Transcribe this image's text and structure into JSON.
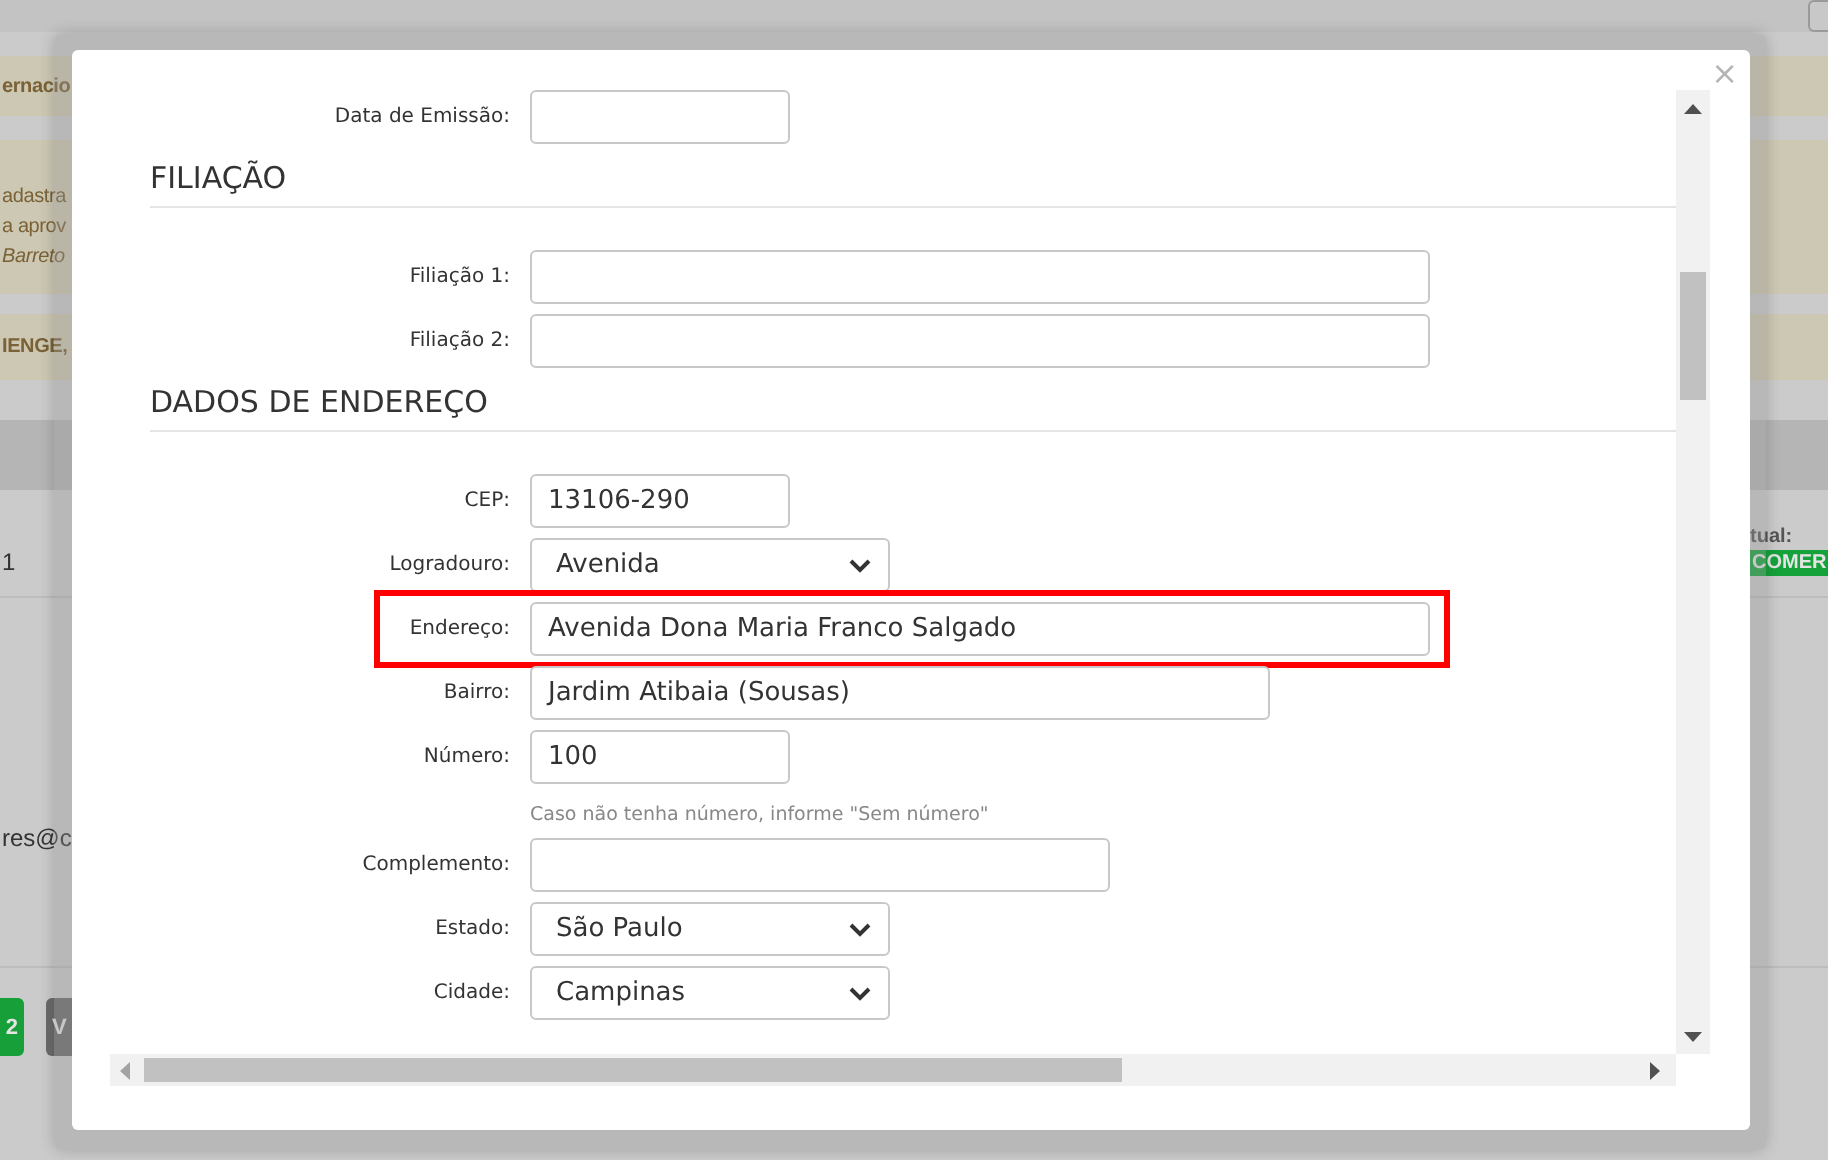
{
  "background": {
    "notices": [
      {
        "lines": [
          "ernacio"
        ]
      },
      {
        "lines": [
          "adastra",
          "a aprov",
          "Barreto"
        ]
      },
      {
        "lines": [
          "IENGE,"
        ]
      }
    ],
    "rows": [
      {
        "text": "1",
        "right_label": "tual:",
        "right_badge": "COMER"
      },
      {
        "text": "res@c"
      }
    ],
    "buttons": [
      {
        "label": "2",
        "color": "#17a03a"
      },
      {
        "label": "V",
        "color": "#6b6b6b"
      }
    ]
  },
  "modal": {
    "close": "×",
    "form": [
      {
        "kind": "input",
        "label": "Data de Emissão:"
      },
      {
        "kind": "heading",
        "text": "FILIAÇÃO"
      },
      {
        "kind": "input",
        "label": "Filiação 1:"
      },
      {
        "kind": "input",
        "label": "Filiação 2:"
      },
      {
        "kind": "heading",
        "text": "DADOS DE ENDEREÇO"
      },
      {
        "kind": "input",
        "label": "CEP:",
        "value": "13106-290"
      },
      {
        "kind": "select",
        "label": "Logradouro:",
        "value": "Avenida"
      },
      {
        "kind": "input",
        "label": "Endereço:",
        "value": "Avenida Dona Maria Franco Salgado",
        "highlighted": true
      },
      {
        "kind": "input",
        "label": "Bairro:",
        "value": "Jardim Atibaia (Sousas)"
      },
      {
        "kind": "input",
        "label": "Número:",
        "value": "100",
        "hint": "Caso não tenha número, informe \"Sem número\""
      },
      {
        "kind": "input",
        "label": "Complemento:"
      },
      {
        "kind": "select",
        "label": "Estado:",
        "value": "São Paulo"
      },
      {
        "kind": "select",
        "label": "Cidade:",
        "value": "Campinas"
      }
    ]
  }
}
